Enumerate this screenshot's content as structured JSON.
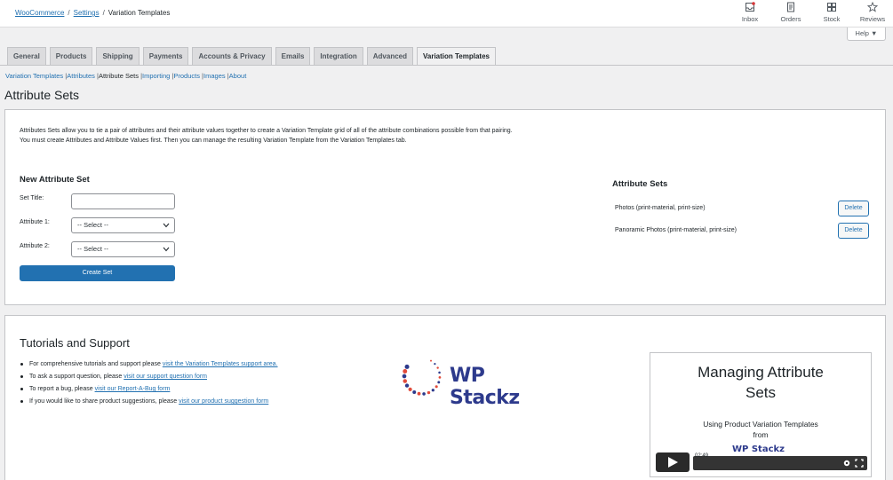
{
  "breadcrumb": {
    "root": "WooCommerce",
    "parent": "Settings",
    "current": "Variation Templates"
  },
  "topnav": [
    {
      "label": "Inbox",
      "icon": "inbox-icon"
    },
    {
      "label": "Orders",
      "icon": "orders-icon"
    },
    {
      "label": "Stock",
      "icon": "stock-icon"
    },
    {
      "label": "Reviews",
      "icon": "star-icon"
    }
  ],
  "help": {
    "label": "Help ▼"
  },
  "tabs": [
    "General",
    "Products",
    "Shipping",
    "Payments",
    "Accounts & Privacy",
    "Emails",
    "Integration",
    "Advanced",
    "Variation Templates"
  ],
  "active_tab": "Variation Templates",
  "subnav": {
    "items": [
      "Variation Templates",
      "Attributes",
      "Attribute Sets",
      "Importing",
      "Products",
      "Images",
      "About"
    ],
    "current": "Attribute Sets"
  },
  "page_title": "Attribute Sets",
  "intro": {
    "line1": "Attributes Sets allow you to tie a pair of attributes and their attribute values together to create a Variation Template grid of all of the attribute combinations possible from that pairing.",
    "line2": "You must create Attributes and Attribute Values first. Then you can manage the resulting Variation Template from the Variation Templates tab."
  },
  "new_set": {
    "title": "New Attribute Set",
    "set_title_label": "Set Title:",
    "set_title_value": "",
    "attribute1_label": "Attribute 1:",
    "attribute1_value": "-- Select --",
    "attribute2_label": "Attribute 2:",
    "attribute2_value": "-- Select --",
    "submit_label": "Create Set"
  },
  "attribute_sets": {
    "title": "Attribute Sets",
    "rows": [
      {
        "name": "Photos (print-material, print-size)",
        "action": "Delete"
      },
      {
        "name": "Panoramic Photos (print-material, print-size)",
        "action": "Delete"
      }
    ]
  },
  "tutorials": {
    "title": "Tutorials and Support",
    "items": [
      {
        "text": "For comprehensive tutorials and support please ",
        "link": "visit the Variation Templates support area."
      },
      {
        "text": "To ask a support question, please ",
        "link": "visit our support question form"
      },
      {
        "text": "To report a bug, please ",
        "link": "visit our Report-A-Bug form"
      },
      {
        "text": "If you would like to share product suggestions, please ",
        "link": "visit our product suggestion form"
      }
    ]
  },
  "logo": {
    "text": "WP Stackz"
  },
  "video": {
    "title_line1": "Managing Attribute",
    "title_line2": "Sets",
    "subtitle_line1": "Using Product Variation Templates",
    "subtitle_line2": "from",
    "logo_text": "WP Stackz",
    "time": "02:49"
  },
  "colors": {
    "accent": "#2271b1",
    "logo": "#2d3a8c",
    "logo_dots": "#e24b3b"
  }
}
